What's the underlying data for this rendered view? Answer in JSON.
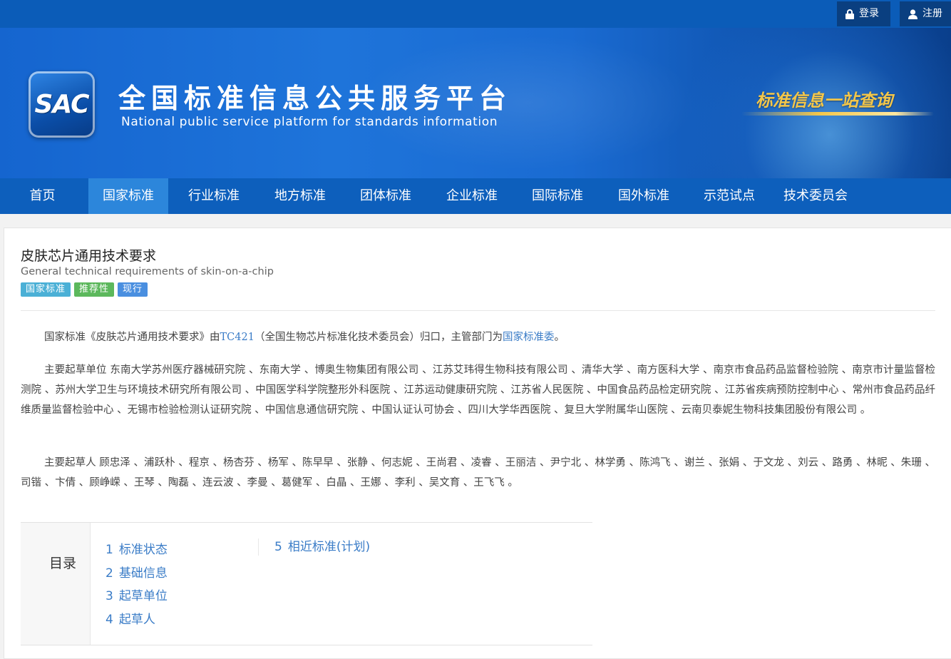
{
  "topbar": {
    "login_label": "登录",
    "register_label": "注册"
  },
  "banner": {
    "logo_text": "SAC",
    "title": "全国标准信息公共服务平台",
    "subtitle": "National public service platform  for standards information",
    "slogan": "标准信息一站查询"
  },
  "nav": {
    "items": [
      "首页",
      "国家标准",
      "行业标准",
      "地方标准",
      "团体标准",
      "企业标准",
      "国际标准",
      "国外标准",
      "示范试点",
      "技术委员会"
    ],
    "active": "国家标准"
  },
  "standard": {
    "title": "皮肤芯片通用技术要求",
    "title_en": "General technical requirements of skin-on-a-chip",
    "tags": [
      "国家标准",
      "推荐性",
      "现行"
    ]
  },
  "intro": {
    "prefix": "国家标准《皮肤芯片通用技术要求》由",
    "tc_link": "TC421",
    "middle": "（全国生物芯片标准化技术委员会）归口，主管部门为",
    "dept_link": "国家标准委",
    "suffix": "。"
  },
  "drafting_units": "主要起草单位 东南大学苏州医疗器械研究院 、东南大学 、博奥生物集团有限公司 、江苏艾玮得生物科技有限公司 、清华大学 、南方医科大学 、南京市食品药品监督检验院 、南京市计量监督检测院 、苏州大学卫生与环境技术研究所有限公司 、中国医学科学院整形外科医院 、江苏运动健康研究院 、江苏省人民医院 、中国食品药品检定研究院 、江苏省疾病预防控制中心 、常州市食品药品纤维质量监督检验中心 、无锡市检验检测认证研究院 、中国信息通信研究院 、中国认证认可协会 、四川大学华西医院 、复旦大学附属华山医院 、云南贝泰妮生物科技集团股份有限公司 。",
  "drafters": "主要起草人 顾忠泽 、浦跃朴 、程京 、杨杏芬 、杨军 、陈早早 、张静 、何志妮 、王尚君 、凌睿 、王丽洁 、尹宁北 、林学勇 、陈鸿飞 、谢兰 、张娟 、于文龙 、刘云 、路勇 、林昵 、朱珊 、司锴 、卞倩 、顾峥嵘 、王琴 、陶磊 、连云波 、李曼 、葛健军 、白晶 、王娜 、李利 、吴文育 、王飞飞 。",
  "toc": {
    "label": "目录",
    "items": [
      {
        "num": "1",
        "label": "标准状态"
      },
      {
        "num": "2",
        "label": "基础信息"
      },
      {
        "num": "3",
        "label": "起草单位"
      },
      {
        "num": "4",
        "label": "起草人"
      },
      {
        "num": "5",
        "label": "相近标准(计划)"
      }
    ]
  }
}
